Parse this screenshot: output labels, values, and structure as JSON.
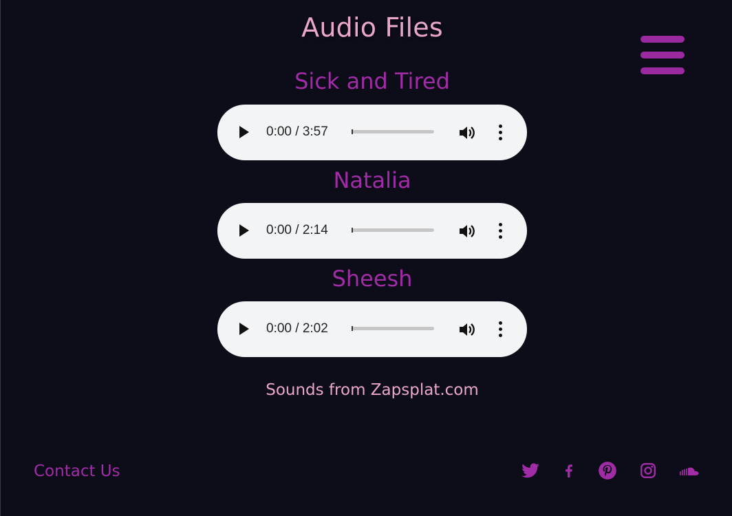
{
  "page": {
    "title": "Audio Files",
    "credit": "Sounds from Zapsplat.com"
  },
  "colors": {
    "background": "#0d0c19",
    "title_pink": "#e9a7c9",
    "accent_purple": "#a02ca6",
    "player_bg": "#f3f4f6"
  },
  "nav": {
    "menu_icon": "hamburger-menu-icon"
  },
  "tracks": [
    {
      "title": "Sick and Tired",
      "current_time": "0:00",
      "duration": "3:57",
      "time_display": "0:00 / 3:57",
      "progress": 0
    },
    {
      "title": "Natalia",
      "current_time": "0:00",
      "duration": "2:14",
      "time_display": "0:00 / 2:14",
      "progress": 0
    },
    {
      "title": "Sheesh",
      "current_time": "0:00",
      "duration": "2:02",
      "time_display": "0:00 / 2:02",
      "progress": 0
    }
  ],
  "footer": {
    "contact_label": "Contact Us",
    "social_icons": [
      "twitter-icon",
      "facebook-icon",
      "pinterest-icon",
      "instagram-icon",
      "soundcloud-icon"
    ]
  }
}
